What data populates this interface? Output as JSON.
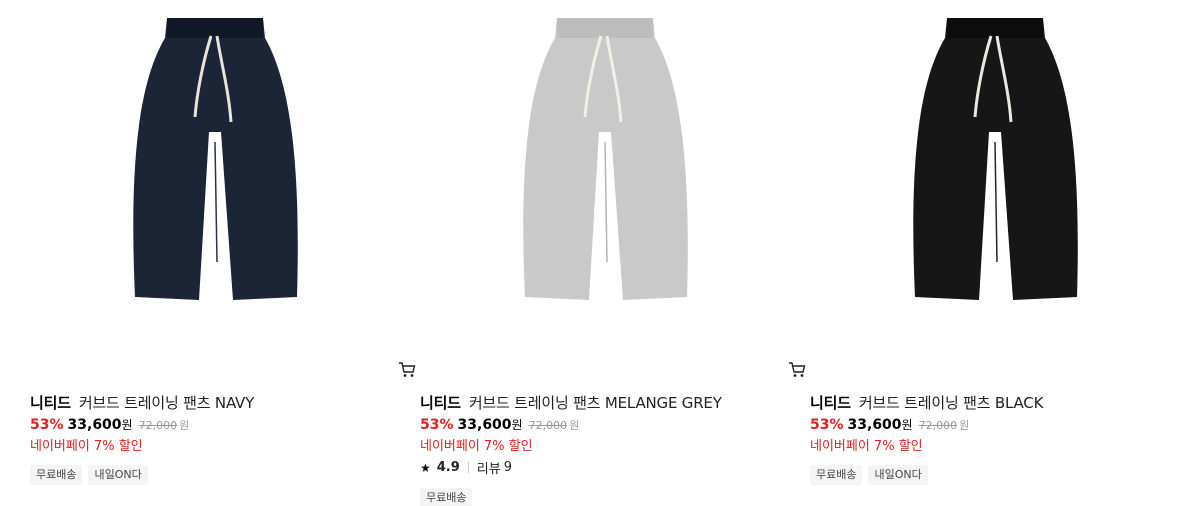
{
  "products": [
    {
      "brand": "니티드",
      "title": "커브드 트레이닝 팬츠 NAVY",
      "discount": "53%",
      "price": "33,600",
      "currency": "원",
      "original_price": "72,000",
      "benefit": "네이버페이 7% 할인",
      "badges": [
        "무료배송",
        "내일ON다"
      ],
      "color": "#1c2536",
      "cart_icon": "cart-icon"
    },
    {
      "brand": "니티드",
      "title": "커브드 트레이닝 팬츠 MELANGE GREY",
      "discount": "53%",
      "price": "33,600",
      "currency": "원",
      "original_price": "72,000",
      "benefit": "네이버페이 7% 할인",
      "rating": {
        "score": "4.9",
        "review_label": "리뷰",
        "review_count": "9"
      },
      "badges": [
        "무료배송"
      ],
      "color": "#c9c9c9",
      "cart_icon": "cart-icon"
    },
    {
      "brand": "니티드",
      "title": "커브드 트레이닝 팬츠 BLACK",
      "discount": "53%",
      "price": "33,600",
      "currency": "원",
      "original_price": "72,000",
      "benefit": "네이버페이 7% 할인",
      "badges": [
        "무료배송",
        "내일ON다"
      ],
      "color": "#161616",
      "cart_icon": "cart-icon"
    }
  ],
  "colors": {
    "discount_red": "#e02020",
    "badge_bg": "#f4f4f4"
  }
}
